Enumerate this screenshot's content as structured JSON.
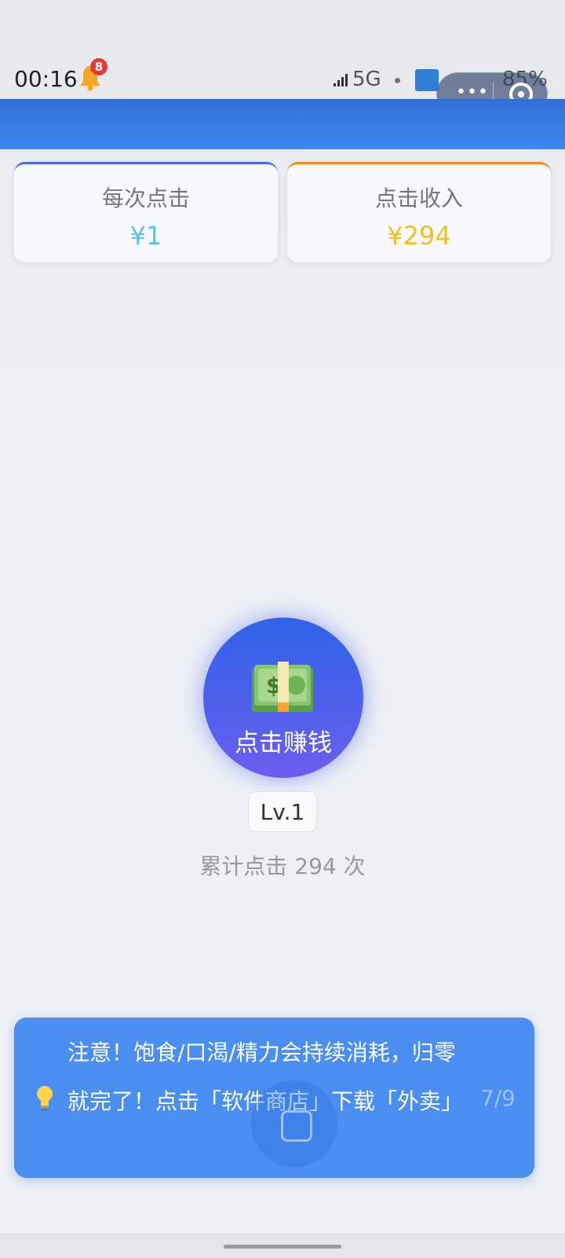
{
  "status_bar": {
    "time": "00:16",
    "notification_count": "8",
    "network": "5G",
    "battery": "85%"
  },
  "stats": {
    "per_click_label": "每次点击",
    "per_click_value": "¥1",
    "income_label": "点击收入",
    "income_value": "¥294"
  },
  "earn": {
    "button_label": "点击赚钱",
    "level": "Lv.1",
    "total_clicks_text": "累计点击 294 次"
  },
  "tip": {
    "text": "注意！饱食/口渴/精力会持续消耗，归零就完了！点击「软件商店」下载「外卖」",
    "page": "7/9"
  },
  "colors": {
    "header": "#3f86f0",
    "per_click_value": "#5bc2ea",
    "income_value": "#f4c020",
    "tip_panel": "#4a8ef1"
  }
}
